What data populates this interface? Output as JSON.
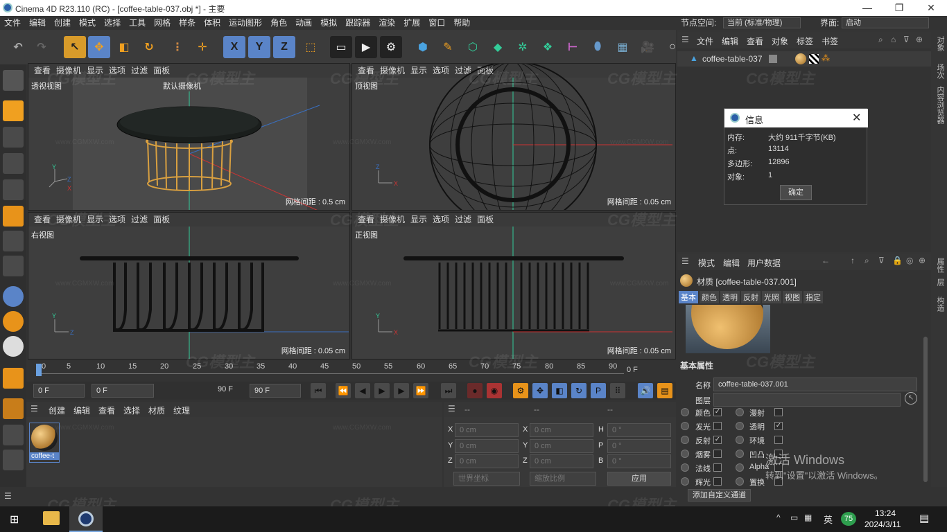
{
  "window": {
    "title": "Cinema 4D R23.110 (RC) - [coffee-table-037.obj *] - 主要",
    "minimize": "—",
    "maximize": "❐",
    "close": "✕"
  },
  "menu": [
    "文件",
    "编辑",
    "创建",
    "模式",
    "选择",
    "工具",
    "网格",
    "样条",
    "体积",
    "运动图形",
    "角色",
    "动画",
    "模拟",
    "跟踪器",
    "渲染",
    "扩展",
    "窗口",
    "帮助"
  ],
  "node_space": {
    "label": "节点空间:",
    "value": "当前 (标准/物理)"
  },
  "interface": {
    "label": "界面:",
    "value": "启动"
  },
  "toolbar": {
    "undo": "undo-icon",
    "redo": "redo-icon",
    "x": "X",
    "y": "Y",
    "z": "Z"
  },
  "viewports": [
    {
      "name": "透视视图",
      "menu": [
        "查看",
        "摄像机",
        "显示",
        "选项",
        "过滤",
        "面板"
      ],
      "camera": "默认摄像机",
      "grid": "网格间距 : 0.5 cm"
    },
    {
      "name": "顶视图",
      "menu": [
        "查看",
        "摄像机",
        "显示",
        "选项",
        "过滤",
        "面板"
      ],
      "grid": "网格间距 : 0.05 cm"
    },
    {
      "name": "右视图",
      "menu": [
        "查看",
        "摄像机",
        "显示",
        "选项",
        "过滤",
        "面板"
      ],
      "grid": "网格间距 : 0.05 cm"
    },
    {
      "name": "正视图",
      "menu": [
        "查看",
        "摄像机",
        "显示",
        "选项",
        "过滤",
        "面板"
      ],
      "grid": "网格间距 : 0.05 cm"
    }
  ],
  "timeline": {
    "ticks": [
      "0",
      "5",
      "10",
      "15",
      "20",
      "25",
      "30",
      "35",
      "40",
      "45",
      "50",
      "55",
      "60",
      "65",
      "70",
      "75",
      "80",
      "85",
      "90"
    ],
    "end": "0 F"
  },
  "playback": {
    "start": "0 F",
    "range_start": "0 F",
    "range_end": "90 F",
    "end": "90 F"
  },
  "material_manager": {
    "menu": [
      "创建",
      "编辑",
      "查看",
      "选择",
      "材质",
      "纹理"
    ],
    "material_name": "coffee-t"
  },
  "coordinates": {
    "headers": [
      "--",
      "--",
      "--"
    ],
    "pos": [
      {
        "axis": "X",
        "val": "0 cm"
      },
      {
        "axis": "Y",
        "val": "0 cm"
      },
      {
        "axis": "Z",
        "val": "0 cm"
      }
    ],
    "size": [
      {
        "axis": "X",
        "val": "0 cm"
      },
      {
        "axis": "Y",
        "val": "0 cm"
      },
      {
        "axis": "Z",
        "val": "0 cm"
      }
    ],
    "rot": [
      {
        "axis": "H",
        "val": "0 °"
      },
      {
        "axis": "P",
        "val": "0 °"
      },
      {
        "axis": "B",
        "val": "0 °"
      }
    ],
    "world": "世界坐标",
    "scale": "缩放比例",
    "apply": "应用"
  },
  "object_manager": {
    "menu": [
      "文件",
      "编辑",
      "查看",
      "对象",
      "标签",
      "书签"
    ],
    "object": "coffee-table-037"
  },
  "info_dialog": {
    "title": "信息",
    "rows": [
      {
        "k": "内存:",
        "v": "大约 911千字节(KB)"
      },
      {
        "k": "点:",
        "v": "13114"
      },
      {
        "k": "多边形:",
        "v": "12896"
      },
      {
        "k": "对象:",
        "v": "1"
      }
    ],
    "ok": "确定"
  },
  "attributes": {
    "menu": [
      "模式",
      "编辑",
      "用户数据"
    ],
    "title": "材质 [coffee-table-037.001]",
    "tabs": [
      "基本",
      "颜色",
      "透明",
      "反射",
      "光照",
      "视图",
      "指定"
    ],
    "section": "基本属性",
    "name_label": "名称",
    "name_value": "coffee-table-037.001",
    "layer_label": "图层",
    "channels_left": [
      {
        "label": "颜色",
        "checked": "✓"
      },
      {
        "label": "发光",
        "checked": ""
      },
      {
        "label": "反射",
        "checked": "✓"
      },
      {
        "label": "烟雾",
        "checked": ""
      },
      {
        "label": "法线",
        "checked": ""
      },
      {
        "label": "辉光",
        "checked": ""
      }
    ],
    "channels_right": [
      {
        "label": "漫射",
        "checked": ""
      },
      {
        "label": "透明",
        "checked": "✓"
      },
      {
        "label": "环境",
        "checked": ""
      },
      {
        "label": "凹凸",
        "checked": ""
      },
      {
        "label": "Alpha",
        "checked": ""
      },
      {
        "label": "置换",
        "checked": ""
      }
    ],
    "add_channel": "添加自定义通道"
  },
  "right_tabs": [
    "对象",
    "场次",
    "内容浏览器"
  ],
  "right_tabs2": [
    "属性",
    "层",
    "构造"
  ],
  "activation": {
    "line1": "激活 Windows",
    "line2": "转到\"设置\"以激活 Windows。"
  },
  "taskbar": {
    "time": "13:24",
    "date": "2024/3/11",
    "ime": "英",
    "badge": "75"
  },
  "watermark": {
    "text": "CG模型主",
    "url": "www.CGMXW.com"
  }
}
